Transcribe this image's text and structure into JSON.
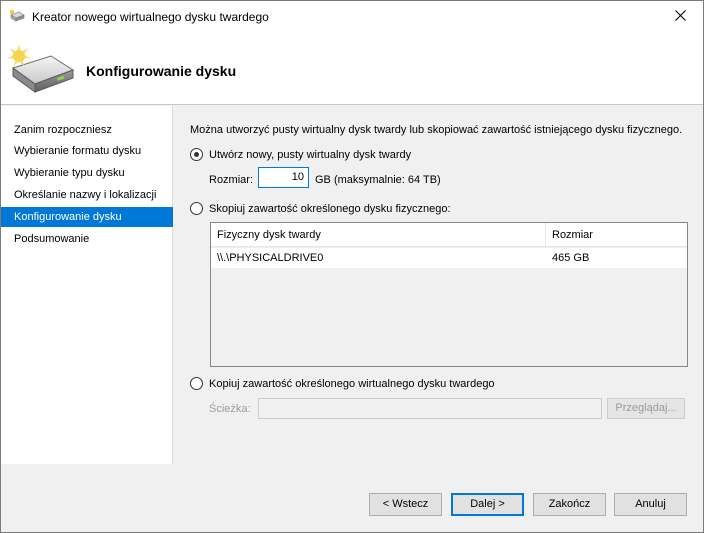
{
  "window": {
    "title": "Kreator nowego wirtualnego dysku twardego"
  },
  "header": {
    "title": "Konfigurowanie dysku"
  },
  "sidebar": {
    "items": [
      {
        "label": "Zanim rozpoczniesz",
        "active": false
      },
      {
        "label": "Wybieranie formatu dysku",
        "active": false
      },
      {
        "label": "Wybieranie typu dysku",
        "active": false
      },
      {
        "label": "Określanie nazwy i lokalizacji",
        "active": false
      },
      {
        "label": "Konfigurowanie dysku",
        "active": true
      },
      {
        "label": "Podsumowanie",
        "active": false
      }
    ]
  },
  "main": {
    "description": "Można utworzyć pusty wirtualny dysk twardy lub skopiować zawartość istniejącego dysku fizycznego.",
    "option_new": {
      "label": "Utwórz nowy, pusty wirtualny dysk twardy",
      "checked": true,
      "size_label": "Rozmiar:",
      "size_value": "10",
      "size_unit": "GB (maksymalnie: 64 TB)"
    },
    "option_physical": {
      "label": "Skopiuj zawartość określonego dysku fizycznego:",
      "checked": false,
      "columns": [
        "Fizyczny dysk twardy",
        "Rozmiar"
      ],
      "rows": [
        {
          "disk": "\\\\.\\PHYSICALDRIVE0",
          "size": "465 GB"
        }
      ]
    },
    "option_virtual": {
      "label": "Kopiuj zawartość określonego wirtualnego dysku twardego",
      "checked": false,
      "path_label": "Ścieżka:",
      "path_value": "",
      "browse_label": "Przeglądaj..."
    }
  },
  "footer": {
    "back_label": "< Wstecz",
    "next_label": "Dalej >",
    "finish_label": "Zakończ",
    "cancel_label": "Anuluj"
  },
  "colors": {
    "accent": "#0078d7",
    "window_bg": "#f0f0f0",
    "disabled_text": "#9a9a9a"
  },
  "icons": {
    "title": "hard-disk-sparkle-icon",
    "header": "hard-disk-sparkle-icon",
    "close": "close-icon"
  }
}
